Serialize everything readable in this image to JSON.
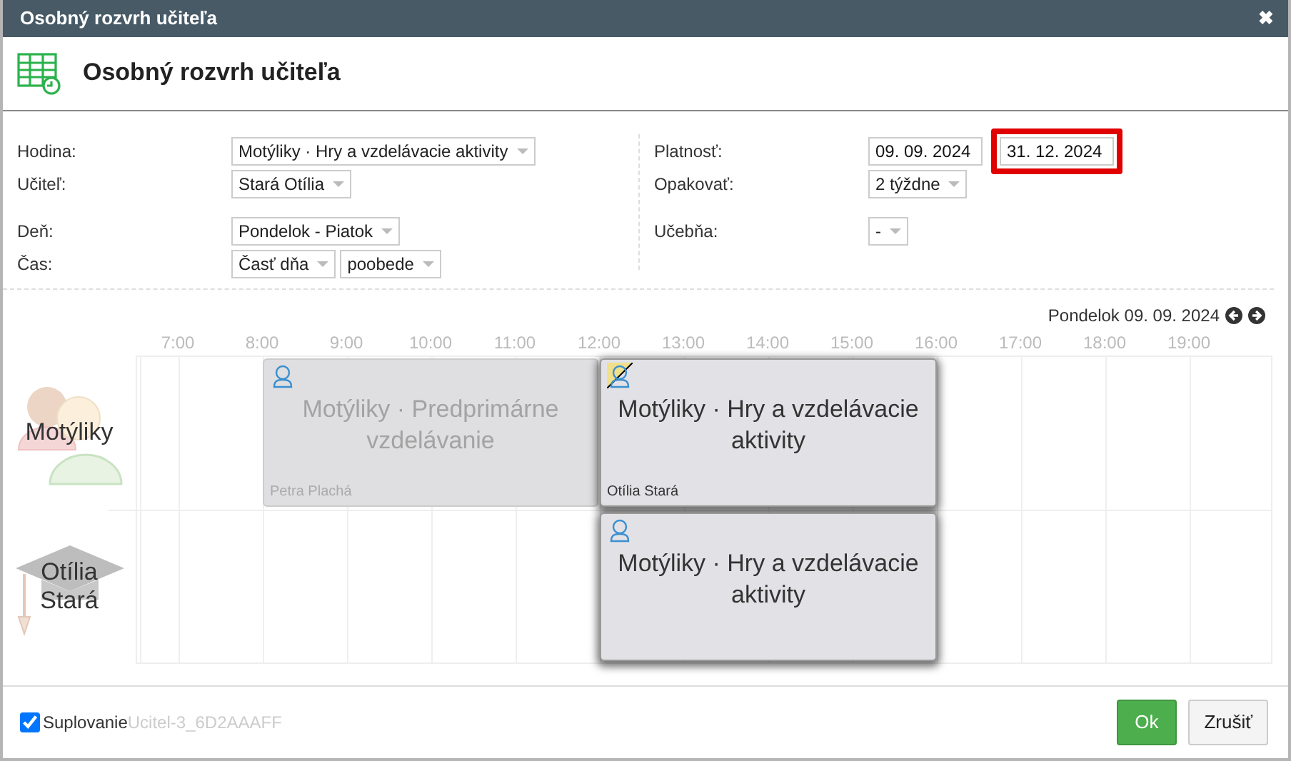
{
  "window": {
    "title": "Osobný rozvrh učiteľa",
    "close": "✖"
  },
  "header": {
    "title": "Osobný rozvrh učiteľa"
  },
  "form": {
    "left_groups": [
      [
        {
          "label": "Hodina:",
          "controls": [
            {
              "kind": "select",
              "value": "Motýliky · Hry a vzdelávacie aktivity"
            }
          ]
        },
        {
          "label": "Učiteľ:",
          "controls": [
            {
              "kind": "select",
              "value": "Stará Otília"
            }
          ]
        }
      ],
      [
        {
          "label": "Deň:",
          "controls": [
            {
              "kind": "select",
              "value": "Pondelok - Piatok"
            }
          ]
        },
        {
          "label": "Čas:",
          "controls": [
            {
              "kind": "select",
              "value": "Časť dňa"
            },
            {
              "kind": "select",
              "value": "poobede"
            }
          ]
        }
      ]
    ],
    "right_groups": [
      [
        {
          "label": "Platnosť:",
          "controls": [
            {
              "kind": "date",
              "value": "09. 09. 2024",
              "highlighted": false
            },
            {
              "kind": "date",
              "value": "31. 12. 2024",
              "highlighted": true
            }
          ]
        },
        {
          "label": "Opakovať:",
          "controls": [
            {
              "kind": "select",
              "value": "2 týždne"
            }
          ]
        }
      ],
      [
        {
          "label": "Učebňa:",
          "controls": [
            {
              "kind": "select",
              "value": "-"
            }
          ]
        }
      ]
    ]
  },
  "schedule": {
    "date": "Pondelok 09. 09. 2024",
    "hours": [
      "7:00",
      "8:00",
      "9:00",
      "10:00",
      "11:00",
      "12:00",
      "13:00",
      "14:00",
      "15:00",
      "16:00",
      "17:00",
      "18:00",
      "19:00"
    ],
    "rows": [
      {
        "kind": "class",
        "label": "Motýliky",
        "events": [
          {
            "title": "Motýliky · Predprimárne vzdelávanie",
            "teacher": "Petra Plachá",
            "selected": false,
            "substituted": false
          },
          {
            "title": "Motýliky · Hry a vzdelávacie aktivity",
            "teacher": "Otília Stará",
            "selected": true,
            "substituted": true
          }
        ]
      },
      {
        "kind": "teacher",
        "label": "Otília Stará",
        "events": [
          {
            "title": "Motýliky · Hry a vzdelávacie aktivity",
            "selected": true,
            "substituted": false
          }
        ]
      }
    ]
  },
  "footer": {
    "checkbox": {
      "label": "Suplovanie",
      "checked": true
    },
    "note": "Ucitel-3_6D2AAAFF",
    "buttons": [
      {
        "kind": "primary",
        "label": "Ok"
      },
      {
        "kind": "secondary",
        "label": "Zrušiť"
      }
    ]
  }
}
